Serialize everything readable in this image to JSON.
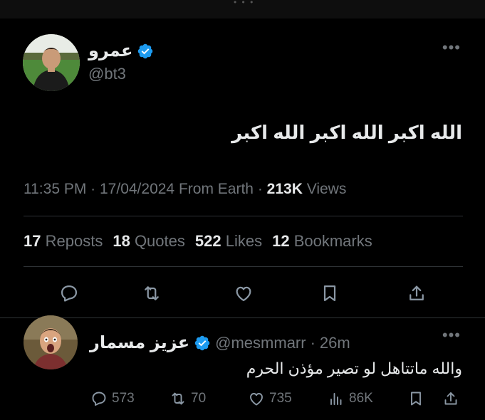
{
  "main_tweet": {
    "display_name": "عمرو",
    "handle": "@bt3",
    "text": "الله اكبر الله اكبر الله اكبر",
    "time": "11:35 PM",
    "date": "17/04/2024",
    "source": "From Earth",
    "views_count": "213K",
    "views_label": "Views",
    "stats": {
      "reposts_count": "17",
      "reposts_label": "Reposts",
      "quotes_count": "18",
      "quotes_label": "Quotes",
      "likes_count": "522",
      "likes_label": "Likes",
      "bookmarks_count": "12",
      "bookmarks_label": "Bookmarks"
    },
    "actions": [
      "reply-icon",
      "repost-icon",
      "like-icon",
      "bookmark-icon",
      "share-icon"
    ]
  },
  "reply_tweet": {
    "display_name": "عزيز مسمار",
    "handle": "@mesmmarr",
    "time_ago": "26m",
    "text": "والله ماتتاهل لو تصير مؤذن الحرم",
    "reply_count": "573",
    "repost_count": "70",
    "like_count": "735",
    "view_count": "86K"
  },
  "colors": {
    "background": "#000000",
    "text": "#e7e9ea",
    "secondary": "#71767b",
    "divider": "#2f3336",
    "verified": "#1d9bf0"
  }
}
